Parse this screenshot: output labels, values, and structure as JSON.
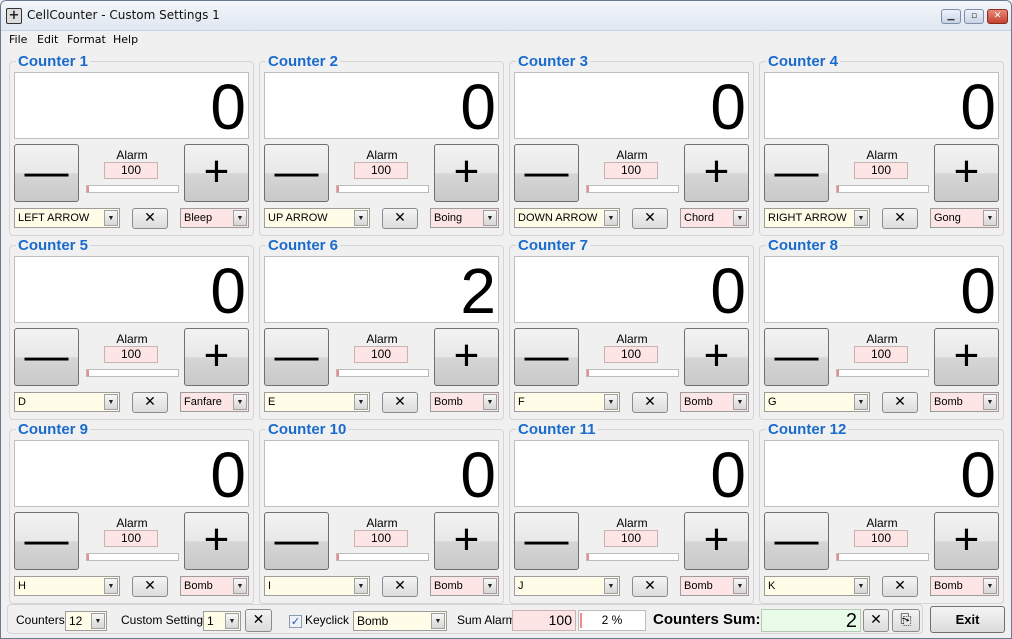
{
  "window": {
    "title": "CellCounter - Custom Settings 1",
    "controls": {
      "minimize": "▁",
      "maximize": "▫",
      "close": "✕"
    }
  },
  "menu": [
    "File",
    "Edit",
    "Format",
    "Help"
  ],
  "alarm_label": "Alarm",
  "minus_symbol": "—",
  "plus_symbol": "+",
  "clear_symbol": "✕",
  "dropdown_symbol": "▼",
  "counters": [
    {
      "name": "Counter 1",
      "value": "0",
      "alarm": "100",
      "progress_pct": 0,
      "key": "LEFT ARROW",
      "sound": "Bleep"
    },
    {
      "name": "Counter 2",
      "value": "0",
      "alarm": "100",
      "progress_pct": 0,
      "key": "UP ARROW",
      "sound": "Boing"
    },
    {
      "name": "Counter 3",
      "value": "0",
      "alarm": "100",
      "progress_pct": 0,
      "key": "DOWN ARROW",
      "sound": "Chord"
    },
    {
      "name": "Counter 4",
      "value": "0",
      "alarm": "100",
      "progress_pct": 0,
      "key": "RIGHT ARROW",
      "sound": "Gong"
    },
    {
      "name": "Counter 5",
      "value": "0",
      "alarm": "100",
      "progress_pct": 0,
      "key": "D",
      "sound": "Fanfare"
    },
    {
      "name": "Counter 6",
      "value": "2",
      "alarm": "100",
      "progress_pct": 2,
      "key": "E",
      "sound": "Bomb"
    },
    {
      "name": "Counter 7",
      "value": "0",
      "alarm": "100",
      "progress_pct": 0,
      "key": "F",
      "sound": "Bomb"
    },
    {
      "name": "Counter 8",
      "value": "0",
      "alarm": "100",
      "progress_pct": 0,
      "key": "G",
      "sound": "Bomb"
    },
    {
      "name": "Counter 9",
      "value": "0",
      "alarm": "100",
      "progress_pct": 0,
      "key": "H",
      "sound": "Bomb"
    },
    {
      "name": "Counter 10",
      "value": "0",
      "alarm": "100",
      "progress_pct": 0,
      "key": "I",
      "sound": "Bomb"
    },
    {
      "name": "Counter 11",
      "value": "0",
      "alarm": "100",
      "progress_pct": 0,
      "key": "J",
      "sound": "Bomb"
    },
    {
      "name": "Counter 12",
      "value": "0",
      "alarm": "100",
      "progress_pct": 0,
      "key": "K",
      "sound": "Bomb"
    }
  ],
  "bottom": {
    "counters_label": "Counters:",
    "counters_value": "12",
    "custom_settings_label": "Custom Settings:",
    "custom_settings_value": "1",
    "keyclick_label": "Keyclick",
    "keyclick_checked": "✓",
    "keyclick_sound": "Bomb",
    "sum_alarm_label": "Sum Alarm:",
    "sum_alarm_value": "100",
    "sum_pct": "2 %",
    "counters_sum_label": "Counters Sum:",
    "counters_sum_value": "2",
    "copy_icon": "⎘",
    "exit_label": "Exit"
  }
}
